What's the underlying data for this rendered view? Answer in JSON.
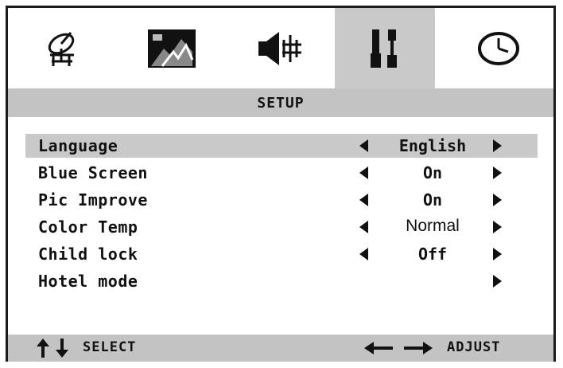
{
  "tabs": [
    {
      "icon": "satellite-dish-icon",
      "active": false
    },
    {
      "icon": "picture-icon",
      "active": false
    },
    {
      "icon": "speaker-icon",
      "active": false
    },
    {
      "icon": "tools-icon",
      "active": true
    },
    {
      "icon": "clock-icon",
      "active": false
    }
  ],
  "title": "SETUP",
  "rows": [
    {
      "label": "Language",
      "value": "English",
      "highlighted": true
    },
    {
      "label": "Blue Screen",
      "value": "On"
    },
    {
      "label": "Pic Improve",
      "value": "On"
    },
    {
      "label": "Color Temp",
      "value": "Normal"
    },
    {
      "label": "Child lock",
      "value": "Off"
    },
    {
      "label": "Hotel mode",
      "value": ""
    }
  ],
  "footer": {
    "select_label": "SELECT",
    "adjust_label": "ADJUST"
  },
  "colors": {
    "bar": "#c3c3c3",
    "highlight": "#c9c9c9",
    "text": "#111111"
  }
}
